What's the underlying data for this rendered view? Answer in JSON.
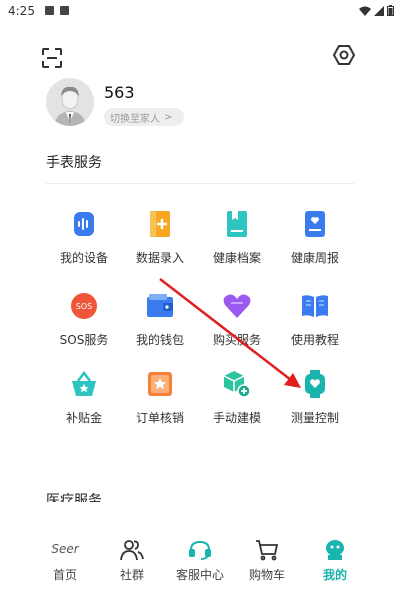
{
  "status_bar": {
    "time": "4:25"
  },
  "header": {
    "scan_icon": "scan-icon",
    "settings_icon": "gear-hex-icon"
  },
  "profile": {
    "name": "563",
    "switch_label": "切换至家人",
    "switch_chevron": ">"
  },
  "watch_services": {
    "title": "手表服务",
    "items": [
      {
        "label": "我的设备",
        "icon": "watch-device-icon",
        "color": "#3a7bf0"
      },
      {
        "label": "数据录入",
        "icon": "data-entry-icon",
        "color": "#f5a623"
      },
      {
        "label": "健康档案",
        "icon": "health-record-icon",
        "color": "#2ec4c0"
      },
      {
        "label": "健康周报",
        "icon": "weekly-report-icon",
        "color": "#3a7bf0"
      },
      {
        "label": "SOS服务",
        "icon": "sos-icon",
        "color": "#f0553a"
      },
      {
        "label": "我的钱包",
        "icon": "wallet-icon",
        "color": "#3a7bf0"
      },
      {
        "label": "购买服务",
        "icon": "heart-icon",
        "color": "#9b59f0"
      },
      {
        "label": "使用教程",
        "icon": "book-icon",
        "color": "#3a7bf0"
      },
      {
        "label": "补贴金",
        "icon": "basket-icon",
        "color": "#2ec4c0"
      },
      {
        "label": "订单核销",
        "icon": "order-icon",
        "color": "#f5803a"
      },
      {
        "label": "手动建模",
        "icon": "modeling-icon",
        "color": "#2ec4a0"
      },
      {
        "label": "测量控制",
        "icon": "measure-watch-icon",
        "color": "#18b4ad"
      }
    ]
  },
  "medical_services": {
    "title": "医疗服务"
  },
  "tab_bar": {
    "tabs": [
      {
        "label": "首页",
        "logo": "Seer",
        "active": false
      },
      {
        "label": "社群",
        "icon": "community-icon",
        "active": false
      },
      {
        "label": "客服中心",
        "icon": "headset-icon",
        "active": false
      },
      {
        "label": "购物车",
        "icon": "cart-icon",
        "active": false
      },
      {
        "label": "我的",
        "icon": "mine-robot-icon",
        "active": true
      }
    ]
  },
  "accent_color": "#18b4ad",
  "annotation_color": "#e02020"
}
